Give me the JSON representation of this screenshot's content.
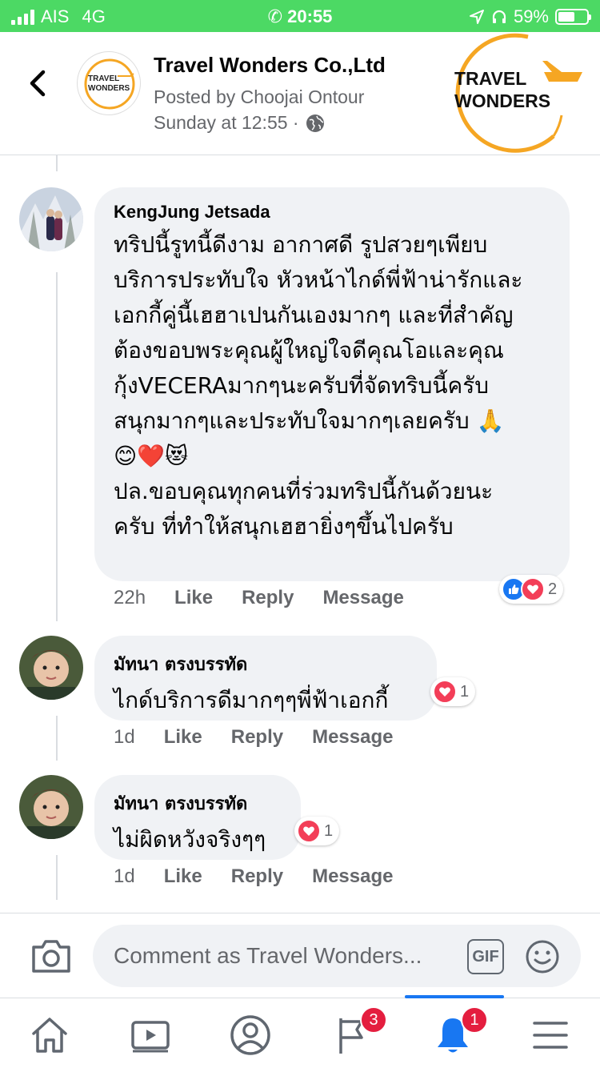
{
  "status_bar": {
    "carrier": "AIS",
    "network": "4G",
    "time": "20:55",
    "battery": "59%",
    "battery_level": 0.59
  },
  "header": {
    "back_icon": "chevron-left-icon",
    "page_name": "Travel Wonders Co.,Ltd",
    "posted_by": "Posted by Choojai Ontour",
    "posted_time": "Sunday at 12:55 ·",
    "privacy_icon": "globe-icon",
    "logo_line1": "TRAVEL",
    "logo_line2": "WONDERS",
    "logo_color": "#f5a623"
  },
  "comments": [
    {
      "author": "KengJung Jetsada",
      "lines": [
        "ทริปนี้รูทนี้ดีงาม อากาศดี รูปสวยๆเพียบ",
        "บริการประทับใจ หัวหน้าไกด์พี่ฟ้าน่ารักและ",
        "เอกกี้คู่นี้เฮฮาเปนกันเองมากๆ และที่สำคัญ",
        "ต้องขอบพระคุณผู้ใหญ่ใจดีคุณโอและคุณ",
        "กุ้งVECERAมากๆนะครับที่จัดทริบนี้ครับ",
        "สนุกมากๆและประทับใจมากๆเลยครับ 🙏",
        "😊❤️😻",
        "ปล.ขอบคุณทุกคนที่ร่วมทริปนี้กันด้วยนะ",
        "ครับ ที่ทำให้สนุกเฮฮายิ่งๆขึ้นไปครับ"
      ],
      "time": "22h",
      "like": "Like",
      "reply": "Reply",
      "message": "Message",
      "reaction_count": "2",
      "reactions": [
        "like",
        "love"
      ]
    },
    {
      "author": "มัทนา ตรงบรรทัด",
      "lines": [
        "ไกด์บริการดีมากๆๆพี่ฟ้าเอกกี้"
      ],
      "time": "1d",
      "like": "Like",
      "reply": "Reply",
      "message": "Message",
      "reaction_count": "1",
      "reactions": [
        "love"
      ]
    },
    {
      "author": "มัทนา ตรงบรรทัด",
      "lines": [
        "ไม่ผิดหวังจริงๆๆ"
      ],
      "time": "1d",
      "like": "Like",
      "reply": "Reply",
      "message": "Message",
      "reaction_count": "1",
      "reactions": [
        "love"
      ]
    }
  ],
  "composer": {
    "placeholder": "Comment as Travel Wonders...",
    "gif_label": "GIF",
    "camera_icon": "camera-icon",
    "emoji_icon": "smiley-icon"
  },
  "tabbar": {
    "tabs": [
      {
        "icon": "home-icon"
      },
      {
        "icon": "video-icon"
      },
      {
        "icon": "profile-icon"
      },
      {
        "icon": "flag-icon",
        "badge": "3"
      },
      {
        "icon": "bell-icon",
        "badge": "1",
        "active": true
      },
      {
        "icon": "menu-icon"
      }
    ]
  },
  "colors": {
    "status_bar": "#4cd964",
    "accent": "#1877f2",
    "badge": "#e41e3f",
    "bubble": "#f0f2f5"
  }
}
